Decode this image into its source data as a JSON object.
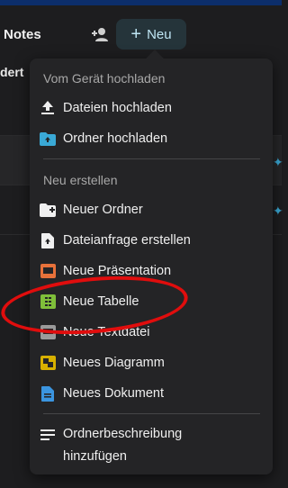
{
  "app": {
    "title": "Notes",
    "subtitle_partial": "dert",
    "new_button_label": "Neu"
  },
  "menu": {
    "upload_section_label": "Vom Gerät hochladen",
    "create_section_label": "Neu erstellen",
    "upload_items": [
      {
        "label": "Dateien hochladen",
        "icon": "upload-icon"
      },
      {
        "label": "Ordner hochladen",
        "icon": "folder-upload-icon"
      }
    ],
    "create_items": [
      {
        "label": "Neuer Ordner",
        "icon": "folder-plus-icon"
      },
      {
        "label": "Dateianfrage erstellen",
        "icon": "file-request-icon"
      },
      {
        "label": "Neue Präsentation",
        "icon": "presentation-icon"
      },
      {
        "label": "Neue Tabelle",
        "icon": "spreadsheet-icon"
      },
      {
        "label": "Neue Textdatei",
        "icon": "text-file-icon"
      },
      {
        "label": "Neues Diagramm",
        "icon": "diagram-icon"
      },
      {
        "label": "Neues Dokument",
        "icon": "document-icon"
      }
    ],
    "description_item": {
      "line1": "Ordnerbeschreibung",
      "line2": "hinzufügen",
      "icon": "description-lines-icon"
    }
  },
  "colors": {
    "accent": "#bfe6f4",
    "highlight_annotation": "#e00d0d",
    "presentation": "#e8713a",
    "spreadsheet": "#7fbf3a",
    "diagram": "#d8b100",
    "document": "#3b95e0",
    "folder": "#3aa9d6"
  }
}
